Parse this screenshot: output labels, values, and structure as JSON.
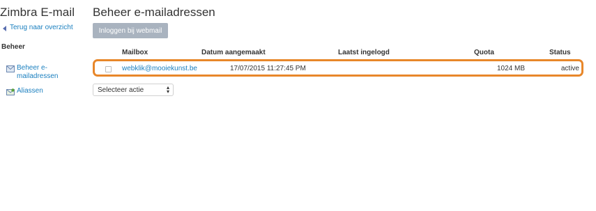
{
  "app": {
    "title": "Zimbra E-mail"
  },
  "sidebar": {
    "back_label": "Terug naar overzicht",
    "section_label": "Beheer",
    "items": [
      {
        "label": "Beheer e-mailadressen",
        "icon": "mail-icon"
      },
      {
        "label": "Aliassen",
        "icon": "alias-icon"
      }
    ]
  },
  "main": {
    "title": "Beheer e-mailadressen",
    "webmail_button": "Inloggen bij webmail",
    "table": {
      "columns": [
        "Mailbox",
        "Datum aangemaakt",
        "Laatst ingelogd",
        "Quota",
        "Status"
      ],
      "rows": [
        {
          "mailbox": "webklik@mooiekunst.be",
          "created": "17/07/2015 11:27:45 PM",
          "last_login": "",
          "quota": "1024 MB",
          "status": "active"
        }
      ]
    },
    "action_select": {
      "selected": "Selecteer actie"
    }
  },
  "colors": {
    "link": "#1a7fbf",
    "highlight": "#e8872a",
    "button_bg": "#a9b3bf"
  }
}
